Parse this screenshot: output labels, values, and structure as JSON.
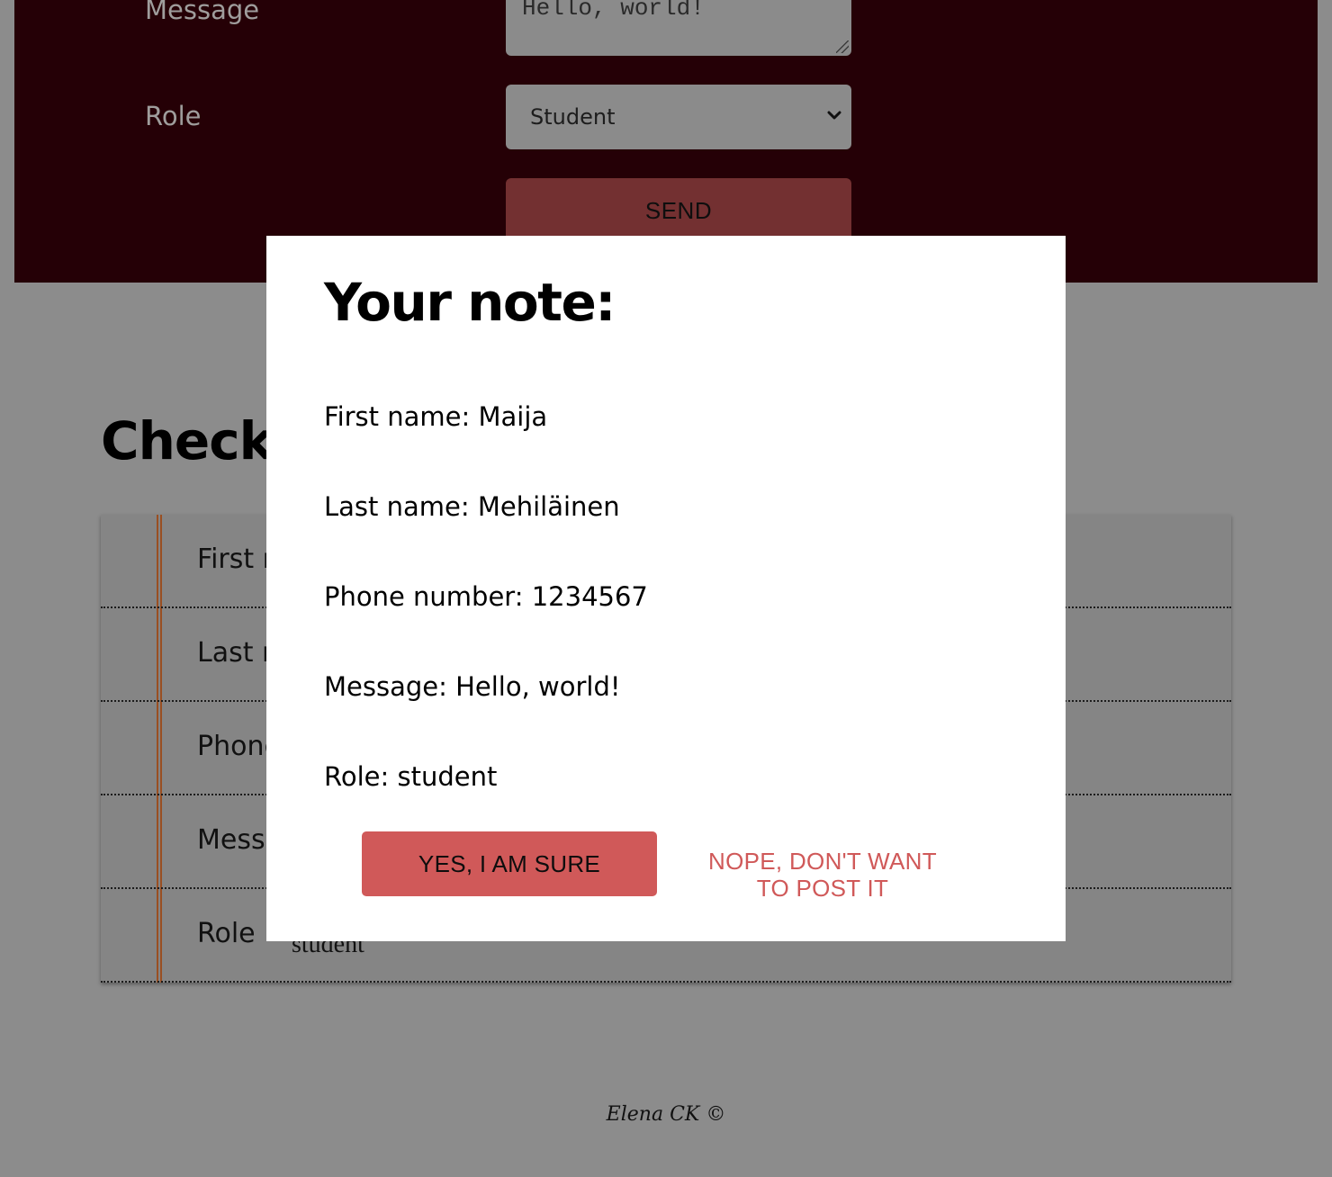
{
  "form": {
    "message_label": "Message",
    "message_value": "Hello, world!",
    "role_label": "Role",
    "role_selected": "Student",
    "send_label": "SEND"
  },
  "check": {
    "title": "Check",
    "rows": [
      {
        "label": "First r",
        "value": ""
      },
      {
        "label": "Last r",
        "value": ""
      },
      {
        "label": "Phone",
        "value": ""
      },
      {
        "label": "Mess",
        "value": ""
      },
      {
        "label": "Role",
        "value": "student"
      }
    ]
  },
  "modal": {
    "title": "Your note:",
    "lines": [
      "First name: Maija",
      "Last name: Mehiläinen",
      "Phone number: 1234567",
      "Message: Hello, world!",
      "Role: student"
    ],
    "confirm_label": "YES, I AM SURE",
    "cancel_label": "NOPE, DON'T WANT TO POST IT"
  },
  "footer": {
    "text": "Elena CK ©"
  },
  "colors": {
    "accent": "#d05959",
    "panel_dimmed": "#250006",
    "overlay_bg": "#8c8c8c"
  }
}
